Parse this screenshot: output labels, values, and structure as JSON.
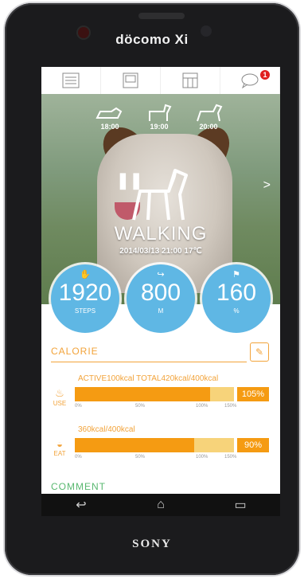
{
  "device": {
    "carrier": "döcomo Xi",
    "brand": "SONY"
  },
  "topbar": {
    "buttons": [
      {
        "name": "list-view",
        "label": ""
      },
      {
        "name": "diary",
        "label": ""
      },
      {
        "name": "calendar",
        "label": ""
      },
      {
        "name": "messages",
        "badge": "1"
      }
    ]
  },
  "history": [
    {
      "time": "18:00",
      "icon": "lying-dog-icon"
    },
    {
      "time": "19:00",
      "icon": "standing-dog-icon"
    },
    {
      "time": "20:00",
      "icon": "walking-dog-icon"
    }
  ],
  "activity": {
    "status": "WALKING",
    "timestamp": "2014/03/13 21:00 17℃"
  },
  "stats": [
    {
      "value": "1920",
      "unit": "STEPS",
      "icon": "paw-icon"
    },
    {
      "value": "800",
      "unit": "M",
      "icon": "route-icon"
    },
    {
      "value": "160",
      "unit": "%",
      "icon": "flag-icon"
    }
  ],
  "calorie": {
    "title": "CALORIE",
    "use": {
      "label": "USE",
      "summary": "ACTIVE100kcal TOTAL420kcal/400kcal",
      "percent_text": "105%",
      "fill_fraction": 0.85,
      "ticks": [
        "0%",
        "50%",
        "100%",
        "150%"
      ]
    },
    "eat": {
      "label": "EAT",
      "summary": "360kcal/400kcal",
      "percent_text": "90%",
      "fill_fraction": 0.75,
      "ticks": [
        "0%",
        "50%",
        "100%",
        "150%"
      ]
    }
  },
  "comment": {
    "title": "COMMENT"
  },
  "colors": {
    "accent": "#f2a33a",
    "bar": "#f59b12",
    "circle": "#5fb7e4",
    "comment": "#59b870"
  }
}
